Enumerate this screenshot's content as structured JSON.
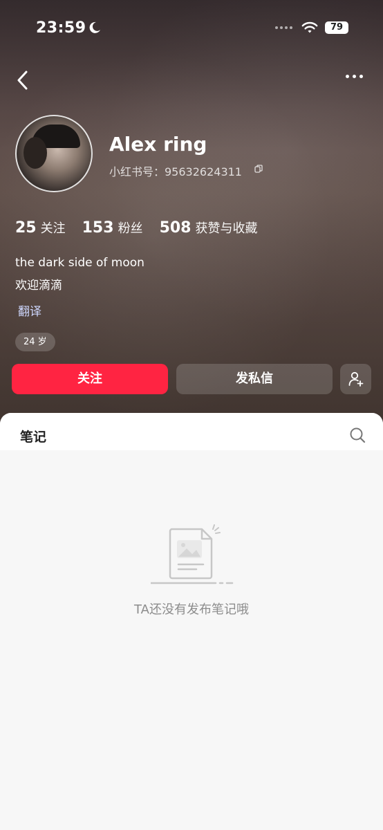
{
  "status_bar": {
    "time": "23:59",
    "battery": "79",
    "icons": [
      "moon-icon",
      "wifi-icon",
      "battery-icon"
    ]
  },
  "nav": {
    "back_icon": "chevron-left-icon",
    "more_icon": "ellipsis-icon"
  },
  "profile": {
    "name": "Alex ring",
    "id_line": "小红书号：95632624311",
    "stats": [
      {
        "num": "25",
        "label": "关注"
      },
      {
        "num": "153",
        "label": "粉丝"
      },
      {
        "num": "508",
        "label": "获赞与收藏"
      }
    ],
    "bio_line1": "the dark side of moon",
    "bio_line2": "欢迎滴滴",
    "translate": "翻译",
    "age": "24 岁"
  },
  "actions": {
    "follow": "关注",
    "message": "发私信",
    "add_friend_icon": "add-user-icon"
  },
  "tabs": {
    "notes": "笔记",
    "search_icon": "search-icon"
  },
  "empty_state": {
    "text": "TA还没有发布笔记哦",
    "icon": "empty-document-icon"
  },
  "colors": {
    "accent": "#ff2442",
    "translate_link": "#cfd8ff",
    "empty_text": "#8c8c8c"
  }
}
